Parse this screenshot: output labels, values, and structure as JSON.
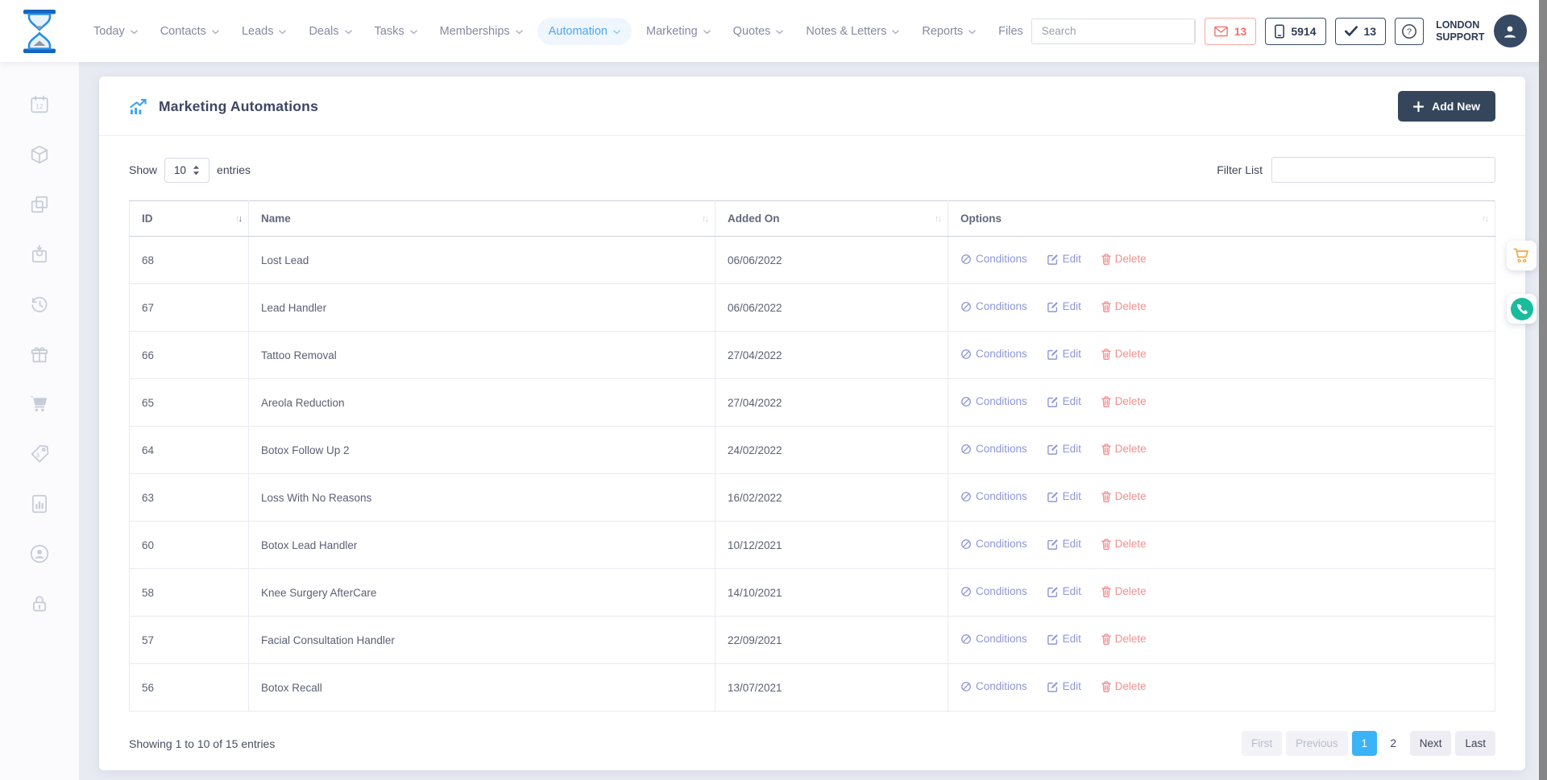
{
  "topbar": {
    "nav_items": [
      {
        "label": "Today",
        "dropdown": true,
        "active": false
      },
      {
        "label": "Contacts",
        "dropdown": true,
        "active": false
      },
      {
        "label": "Leads",
        "dropdown": true,
        "active": false
      },
      {
        "label": "Deals",
        "dropdown": true,
        "active": false
      },
      {
        "label": "Tasks",
        "dropdown": true,
        "active": false
      },
      {
        "label": "Memberships",
        "dropdown": true,
        "active": false
      },
      {
        "label": "Automation",
        "dropdown": true,
        "active": true
      },
      {
        "label": "Marketing",
        "dropdown": true,
        "active": false
      },
      {
        "label": "Quotes",
        "dropdown": true,
        "active": false
      },
      {
        "label": "Notes & Letters",
        "dropdown": true,
        "active": false
      },
      {
        "label": "Reports",
        "dropdown": true,
        "active": false
      },
      {
        "label": "Files",
        "dropdown": false,
        "active": false
      }
    ],
    "search_placeholder": "Search",
    "mail_count": "13",
    "phone_count": "5914",
    "check_count": "13",
    "account_line1": "LONDON",
    "account_line2": "SUPPORT"
  },
  "sidebar": {
    "icons": [
      "calendar-icon",
      "cube-icon",
      "copy-icon",
      "bag-download-icon",
      "history-icon",
      "gift-icon",
      "cart-icon",
      "price-tag-icon",
      "report-icon",
      "support-icon",
      "lock-icon"
    ]
  },
  "main": {
    "title": "Marketing Automations",
    "add_new": "Add New",
    "show_label": "Show",
    "page_size": "10",
    "entries_label": "entries",
    "filter_label": "Filter List",
    "table": {
      "columns": [
        {
          "label": "ID",
          "sort": "desc"
        },
        {
          "label": "Name",
          "sort": "none"
        },
        {
          "label": "Added On",
          "sort": "none"
        },
        {
          "label": "Options",
          "sort": "none"
        }
      ],
      "actions": {
        "conditions": "Conditions",
        "edit": "Edit",
        "delete": "Delete"
      },
      "rows": [
        {
          "id": "68",
          "name": "Lost Lead",
          "added_on": "06/06/2022"
        },
        {
          "id": "67",
          "name": "Lead Handler",
          "added_on": "06/06/2022"
        },
        {
          "id": "66",
          "name": "Tattoo Removal",
          "added_on": "27/04/2022"
        },
        {
          "id": "65",
          "name": "Areola Reduction",
          "added_on": "27/04/2022"
        },
        {
          "id": "64",
          "name": "Botox Follow Up 2",
          "added_on": "24/02/2022"
        },
        {
          "id": "63",
          "name": "Loss With No Reasons",
          "added_on": "16/02/2022"
        },
        {
          "id": "60",
          "name": "Botox Lead Handler",
          "added_on": "10/12/2021"
        },
        {
          "id": "58",
          "name": "Knee Surgery AfterCare",
          "added_on": "14/10/2021"
        },
        {
          "id": "57",
          "name": "Facial Consultation Handler",
          "added_on": "22/09/2021"
        },
        {
          "id": "56",
          "name": "Botox Recall",
          "added_on": "13/07/2021"
        }
      ]
    },
    "footer_summary": "Showing 1 to 10 of 15 entries",
    "pagination": [
      {
        "label": "First",
        "state": "disabled"
      },
      {
        "label": "Previous",
        "state": "disabled"
      },
      {
        "label": "1",
        "state": "active"
      },
      {
        "label": "2",
        "state": "plain"
      },
      {
        "label": "Next",
        "state": "normal"
      },
      {
        "label": "Last",
        "state": "normal"
      }
    ]
  },
  "colors": {
    "accent_blue": "#4aa7f3",
    "dark_navy": "#35465c",
    "active_page_blue": "#3bb3f7",
    "link_indigo": "#8d97d6",
    "link_red": "#f28f8d",
    "mail_red": "#f0716c",
    "cart_orange": "#f5a83c",
    "phone_teal": "#19bc9c"
  }
}
